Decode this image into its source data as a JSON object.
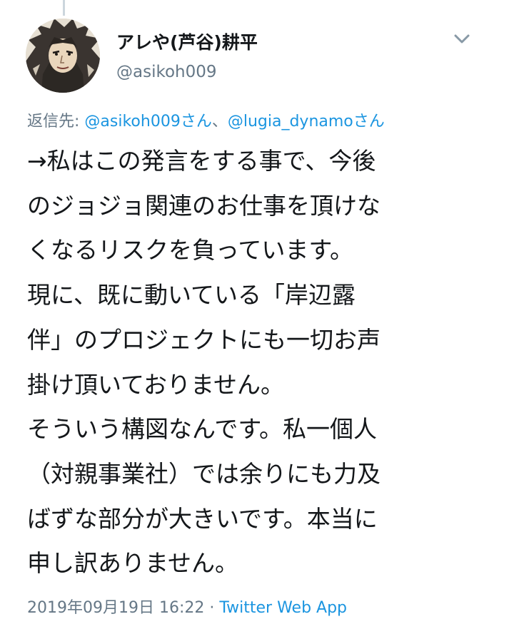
{
  "tweet": {
    "display_name": "アレや(芦谷)耕平",
    "handle": "@asikoh009",
    "reply_prefix": "返信先: ",
    "reply_to_1": "@asikoh009さん",
    "reply_separator": "、",
    "reply_to_2": "@lugia_dynamoさん",
    "body_lines": [
      "→私はこの発言をする事で、今後",
      "のジョジョ関連のお仕事を頂けな",
      "くなるリスクを負っています。",
      "現に、既に動いている「岸辺露",
      "伴」のプロジェクトにも一切お声",
      "掛け頂いておりません。",
      "そういう構図なんです。私一個人",
      "（対親事業社）では余りにも力及",
      "ばずな部分が大きいです。本当に",
      "申し訳ありません。"
    ],
    "timestamp": "2019年09月19日 16:22",
    "meta_separator": " · ",
    "source_app": "Twitter Web App"
  },
  "icons": {
    "caret": "chevron-down-icon",
    "avatar": "user-avatar"
  },
  "colors": {
    "text": "#14171a",
    "secondary": "#657786",
    "link": "#1b95e0"
  }
}
